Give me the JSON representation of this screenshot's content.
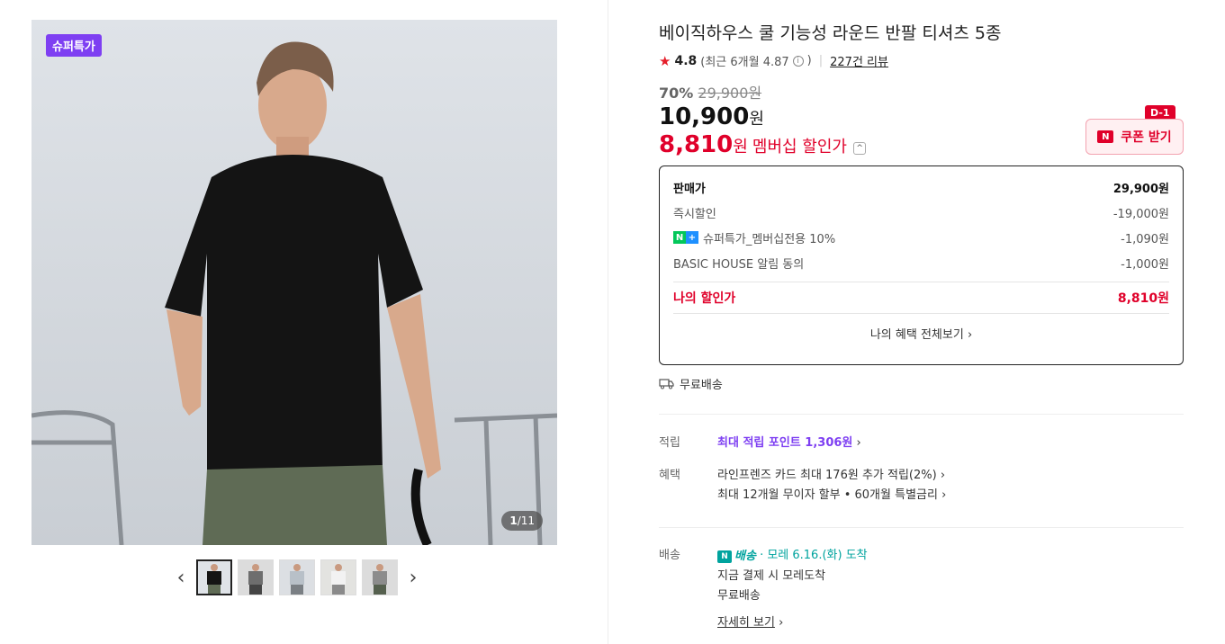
{
  "gallery": {
    "badge": "슈퍼특가",
    "pager_current": "1",
    "pager_total": "/11",
    "prev_icon": "chevron-left-icon",
    "next_icon": "chevron-right-icon"
  },
  "product": {
    "title": "베이직하우스 쿨 기능성 라운드 반팔 티셔츠 5종",
    "rating": "4.8",
    "recent_prefix": "(최근 6개월 4.87",
    "recent_suffix": ")",
    "reviews": "227건 리뷰",
    "discount_pct": "70%",
    "original_price": "29,900원",
    "price": "10,900",
    "price_unit": "원",
    "member_price": "8,810",
    "member_unit": "원",
    "member_label": "멤버십 할인가"
  },
  "coupon": {
    "label": "쿠폰 받기",
    "badge": "D-1",
    "n": "N"
  },
  "breakdown": {
    "rows": [
      {
        "label": "판매가",
        "value": "29,900원"
      },
      {
        "label": "즉시할인",
        "value": "-19,000원"
      },
      {
        "label": "슈퍼특가_멤버십전용 10%",
        "value": "-1,090원"
      },
      {
        "label": "BASIC HOUSE 알림 동의",
        "value": "-1,000원"
      }
    ],
    "mine_label": "나의 할인가",
    "mine_value": "8,810원",
    "view_all": "나의 혜택 전체보기"
  },
  "shipping_free": "무료배송",
  "points": {
    "key": "적립",
    "value": "최대 적립 포인트 1,306원"
  },
  "benefits": {
    "key": "혜택",
    "line1": "라인프렌즈 카드 최대 176원 추가 적립(2%)",
    "line2": "최대 12개월 무이자 할부 • 60개월 특별금리"
  },
  "delivery": {
    "key": "배송",
    "npay_label": "배송",
    "arrival": "모레 6.16.(화) 도착",
    "line2": "지금 결제 시 모레도착",
    "line3": "무료배송",
    "detail": "자세히 보기"
  }
}
